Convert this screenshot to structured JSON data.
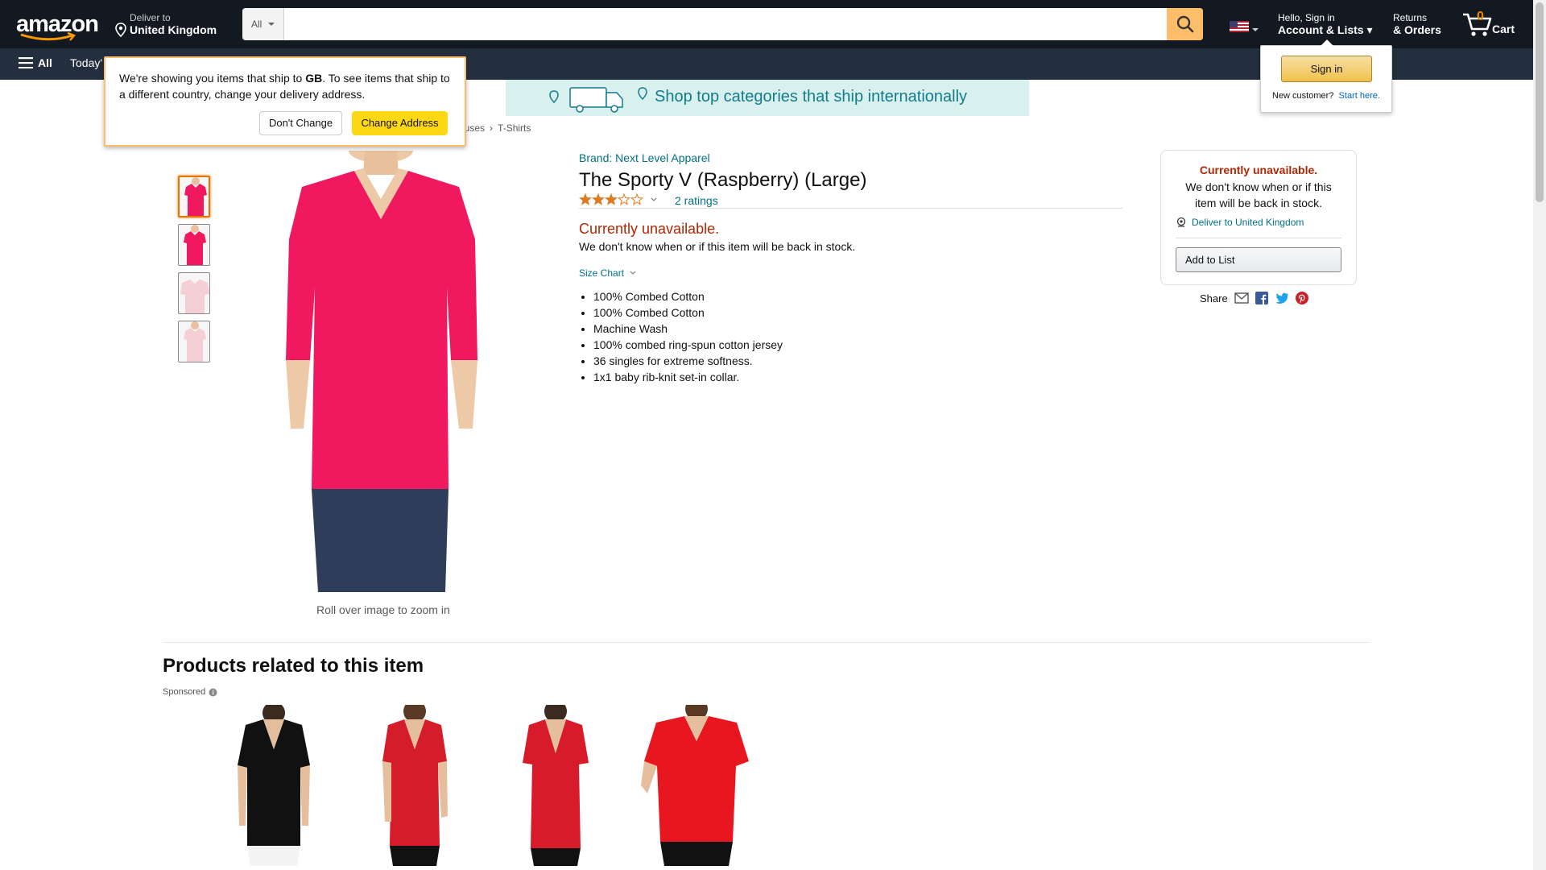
{
  "header": {
    "logo": "amazon",
    "deliver_to_label": "Deliver to",
    "deliver_to_country": "United Kingdom",
    "search_category": "All",
    "search_placeholder": "",
    "account_greeting": "Hello, Sign in",
    "account_label": "Account & Lists",
    "returns_l1": "Returns",
    "returns_l2": "& Orders",
    "cart_count": "0",
    "cart_label": "Cart",
    "menu_all": "All",
    "today_deals": "Today'"
  },
  "location_popup": {
    "text_before": "We're showing you items that ship to ",
    "country_code": "GB",
    "text_after": ". To see items that ship to a different country, change your delivery address.",
    "dont_change": "Don't Change",
    "change_address": "Change Address"
  },
  "signin_popover": {
    "button": "Sign in",
    "new_customer": "New customer?",
    "start_here": "Start here."
  },
  "banner": {
    "text": "Shop top categories that ship internationally"
  },
  "breadcrumb": {
    "prev": "ouses",
    "sep": "›",
    "current": "T-Shirts"
  },
  "product": {
    "brand": "Brand: Next Level Apparel",
    "title": "The Sporty V (Raspberry) (Large)",
    "rating_value": 3,
    "rating_max": 5,
    "ratings_count": "2 ratings",
    "unavailable": "Currently unavailable.",
    "unavailable_sub": "We don't know when or if this item will be back in stock.",
    "size_chart": "Size Chart",
    "bullets": [
      "100% Combed Cotton",
      "100% Combed Cotton",
      "Machine Wash",
      "100% combed ring-spun cotton jersey",
      "36 singles for extreme softness.",
      "1x1 baby rib-knit set-in collar."
    ],
    "zoom_hint": "Roll over image to zoom in"
  },
  "buybox": {
    "unavailable": "Currently unavailable.",
    "sub": "We don't know when or if this item will be back in stock.",
    "deliver": "Deliver to United Kingdom",
    "add_to_list": "Add to List",
    "share": "Share"
  },
  "related": {
    "title": "Products related to this item",
    "sponsored": "Sponsored"
  },
  "colors": {
    "nav_dark": "#131921",
    "nav_sub": "#232f3e",
    "accent_yellow": "#ffd814",
    "price_red": "#b12704",
    "link_teal": "#007185",
    "shirt_raspberry": "#f0195f"
  }
}
